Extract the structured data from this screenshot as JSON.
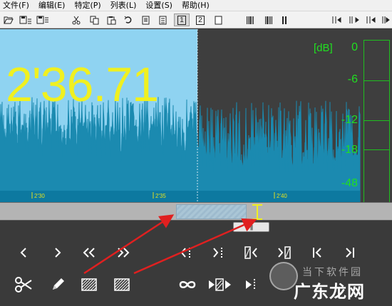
{
  "menu": {
    "file": "文件(F)",
    "edit": "编辑(E)",
    "special": "特定(P)",
    "list": "列表(L)",
    "settings": "设置(S)",
    "help": "帮助(H)"
  },
  "toolbar": {
    "page1": "1",
    "page2": "2"
  },
  "display": {
    "time": "2'36.71",
    "db_unit": "[dB]",
    "db_levels": [
      "0",
      "-6",
      "-12",
      "-18",
      "-48"
    ],
    "timeline": [
      "2'30",
      "2'35",
      "2'40"
    ]
  },
  "colors": {
    "selected_bg": "#8fd3f1",
    "wave_fill": "#1b8ab0",
    "unselected_bg": "#3e3e3e",
    "readout": "#f0f020",
    "meter": "#20e020",
    "annotation_arrow": "#e02020"
  },
  "controls": {
    "row1": [
      "chevron-left-icon",
      "chevron-right-icon",
      "double-chevron-left-icon",
      "double-chevron-right-icon",
      "mark-left-icon",
      "mark-right-icon",
      "bar-left-icon",
      "bar-right-icon",
      "to-start-icon",
      "to-end-icon"
    ],
    "row2": [
      "scissors-icon",
      "pencil-icon",
      "hatched-square-icon",
      "hatched-square-icon",
      "loop-icon",
      "play-selection-icon",
      "play-from-mark-icon"
    ]
  },
  "watermark": {
    "line1": "当下软件园",
    "line2": "广东龙网"
  }
}
